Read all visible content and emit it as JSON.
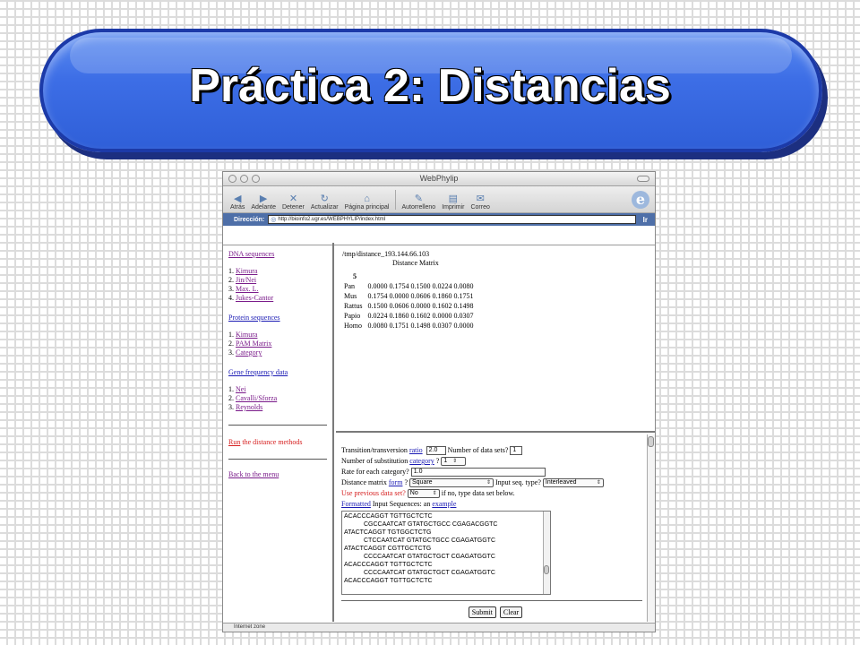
{
  "slide": {
    "title": "Práctica 2: Distancias"
  },
  "browser": {
    "window_title": "WebPhylip",
    "toolbar": [
      {
        "label": "Atrás",
        "icon": "back-arrow-icon",
        "glyph": "◀"
      },
      {
        "label": "Adelante",
        "icon": "forward-arrow-icon",
        "glyph": "▶"
      },
      {
        "label": "Detener",
        "icon": "stop-icon",
        "glyph": "✕"
      },
      {
        "label": "Actualizar",
        "icon": "refresh-icon",
        "glyph": "↻"
      },
      {
        "label": "Página principal",
        "icon": "home-icon",
        "glyph": "⌂"
      },
      {
        "label": "Autorrelleno",
        "icon": "autofill-icon",
        "glyph": "✎"
      },
      {
        "label": "Imprimir",
        "icon": "print-icon",
        "glyph": "▤"
      },
      {
        "label": "Correo",
        "icon": "mail-icon",
        "glyph": "✉"
      }
    ],
    "address_label": "Dirección:",
    "url": "http://bioinfo2.ugr.es/WEBPHYLIP/index.html",
    "go_label": "Ir",
    "status": "Internet zone"
  },
  "left_menu": {
    "dna_title": "DNA sequences",
    "dna_items": [
      {
        "num": "1.",
        "label": "Kimura"
      },
      {
        "num": "2.",
        "label": "Jin/Nei"
      },
      {
        "num": "3.",
        "label": "Max. L."
      },
      {
        "num": "4.",
        "label": "Jukes-Cantor"
      }
    ],
    "protein_title": "Protein sequences",
    "protein_items": [
      {
        "num": "1.",
        "label": "Kimura"
      },
      {
        "num": "2.",
        "label": "PAM Matrix"
      },
      {
        "num": "3.",
        "label": "Category"
      }
    ],
    "gene_title": "Gene frequency data",
    "gene_items": [
      {
        "num": "1.",
        "label": "Nei"
      },
      {
        "num": "2.",
        "label": "Cavalli/Sforza"
      },
      {
        "num": "3.",
        "label": "Reynolds"
      }
    ],
    "run_link": "Run",
    "run_text": " the distance methods",
    "back_link": "Back to the menu"
  },
  "output": {
    "path": "/tmp/distance_193.144.66.103",
    "heading": "Distance Matrix",
    "n": "5",
    "rows": [
      {
        "name": "Pan",
        "values": "0.0000 0.1754 0.1500 0.0224 0.0080"
      },
      {
        "name": "Mus",
        "values": "0.1754 0.0000 0.0606 0.1860 0.1751"
      },
      {
        "name": "Rattus",
        "values": "0.1500 0.0606 0.0000 0.1602 0.1498"
      },
      {
        "name": "Papio",
        "values": "0.0224 0.1860 0.1602 0.0000 0.0307"
      },
      {
        "name": "Homo",
        "values": "0.0080 0.1751 0.1498 0.0307 0.0000"
      }
    ]
  },
  "form": {
    "ratio_text": "Transition/transversion ",
    "ratio_link": "ratio",
    "ratio_value": "2.0",
    "datasets_text": " Number of data sets?",
    "datasets_value": "1",
    "subst_text": "Number of substitution ",
    "subst_link": "category",
    "subst_q": "?",
    "subst_value": "1",
    "rate_text": "Rate for each category?",
    "rate_value": "1.0",
    "matrix_text": "Distance matrix ",
    "matrix_link": "form",
    "matrix_q": "?",
    "matrix_value": "Square",
    "seqtype_text": " Input seq. type?",
    "seqtype_value": "Interleaved",
    "prev_text": "Use previous data set?",
    "prev_value": "No",
    "prev_suffix": " if no, type data set below.",
    "formatted_link": "Formatted",
    "formatted_text": " Input Sequences: an ",
    "example_link": "example",
    "sequences": [
      {
        "text": "ACACCCAGGT TGTTGCTCTC",
        "indent": false
      },
      {
        "text": "CGCCAATCAT GTATGCTGCC CGAGACGGTC",
        "indent": true
      },
      {
        "text": "ATACTCAGGT TGTGGCTCTG",
        "indent": false
      },
      {
        "text": "CTCCAATCAT GTATGCTGCC CGAGATGGTC",
        "indent": true
      },
      {
        "text": "ATACTCAGGT CGTTGCTCTG",
        "indent": false
      },
      {
        "text": "CCCCAATCAT GTATGCTGCT CGAGATGGTC",
        "indent": true
      },
      {
        "text": "ACACCCAGGT TGTTGCTCTC",
        "indent": false
      },
      {
        "text": "CCCCAATCAT GTATGCTGCT CGAGATGGTC",
        "indent": true
      },
      {
        "text": "ACACCCAGGT TGTTGCTCTC",
        "indent": false
      }
    ],
    "submit_label": "Submit",
    "clear_label": "Clear"
  }
}
